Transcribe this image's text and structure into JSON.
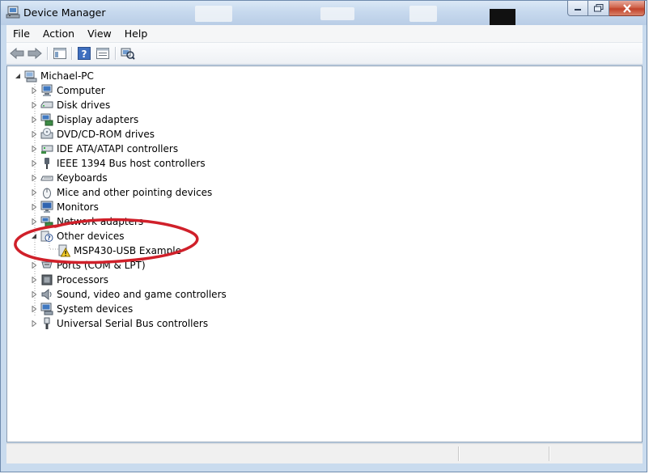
{
  "window": {
    "title": "Device Manager"
  },
  "menu": [
    {
      "label": "File"
    },
    {
      "label": "Action"
    },
    {
      "label": "View"
    },
    {
      "label": "Help"
    }
  ],
  "toolbar": {
    "buttons": [
      "back-arrow-icon",
      "forward-arrow-icon",
      "show-hide-console-tree-icon",
      "help-icon",
      "properties-icon",
      "scan-hardware-icon"
    ]
  },
  "tree": {
    "root": {
      "label": "Michael-PC",
      "expanded": true
    },
    "items": [
      {
        "label": "Computer",
        "icon": "computer-icon"
      },
      {
        "label": "Disk drives",
        "icon": "disk-drive-icon"
      },
      {
        "label": "Display adapters",
        "icon": "display-adapter-icon"
      },
      {
        "label": "DVD/CD-ROM drives",
        "icon": "dvd-drive-icon"
      },
      {
        "label": "IDE ATA/ATAPI controllers",
        "icon": "ide-controller-icon"
      },
      {
        "label": "IEEE 1394 Bus host controllers",
        "icon": "ieee1394-icon"
      },
      {
        "label": "Keyboards",
        "icon": "keyboard-icon"
      },
      {
        "label": "Mice and other pointing devices",
        "icon": "mouse-icon"
      },
      {
        "label": "Monitors",
        "icon": "monitor-icon"
      },
      {
        "label": "Network adapters",
        "icon": "network-adapter-icon"
      },
      {
        "label": "Other devices",
        "icon": "unknown-device-icon",
        "expanded": true
      },
      {
        "label": "MSP430-USB Example",
        "icon": "warning-device-icon",
        "child": true
      },
      {
        "label": "Ports (COM & LPT)",
        "icon": "port-icon"
      },
      {
        "label": "Processors",
        "icon": "processor-icon"
      },
      {
        "label": "Sound, video and game controllers",
        "icon": "speaker-icon"
      },
      {
        "label": "System devices",
        "icon": "system-device-icon"
      },
      {
        "label": "Universal Serial Bus controllers",
        "icon": "usb-icon"
      }
    ]
  },
  "annotation": {
    "color": "#d0202a"
  }
}
